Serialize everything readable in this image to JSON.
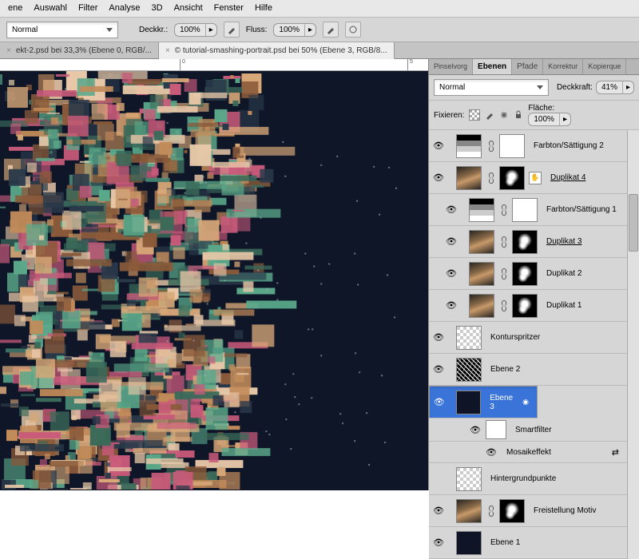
{
  "menu": [
    "ene",
    "Auswahl",
    "Filter",
    "Analyse",
    "3D",
    "Ansicht",
    "Fenster",
    "Hilfe"
  ],
  "toolbar": {
    "blend": "Normal",
    "opacity_lbl": "Deckkr.:",
    "opacity": "100%",
    "flow_lbl": "Fluss:",
    "flow": "100%"
  },
  "doc_tabs": [
    {
      "label": "ekt-2.psd bei 33,3% (Ebene 0, RGB/...",
      "active": false
    },
    {
      "label": "© tutorial-smashing-portrait.psd bei 50% (Ebene 3, RGB/8...",
      "active": true
    }
  ],
  "panel_tabs": [
    "Pinselvorg",
    "Ebenen",
    "Pfade",
    "Korrektur",
    "Kopierque"
  ],
  "panel_tabs_active": 1,
  "layer_opts": {
    "blend": "Normal",
    "opacity_lbl": "Deckkraft:",
    "opacity": "41%",
    "lock_lbl": "Fixieren:",
    "fill_lbl": "Fläche:",
    "fill": "100%"
  },
  "layers": [
    {
      "eye": true,
      "thumbs": [
        "grad",
        "white"
      ],
      "link": true,
      "name": "Farbton/Sättigung 2",
      "u": false
    },
    {
      "eye": true,
      "thumbs": [
        "port",
        "mask"
      ],
      "link": true,
      "name": "Duplikat 4",
      "u": true,
      "hand": true
    },
    {
      "eye": true,
      "thumbs": [
        "grad",
        "white"
      ],
      "link": true,
      "name": "Farbton/Sättigung 1",
      "u": false,
      "indent": 1
    },
    {
      "eye": true,
      "thumbs": [
        "port",
        "mask"
      ],
      "link": true,
      "name": "Duplikat 3",
      "u": true,
      "indent": 1
    },
    {
      "eye": true,
      "thumbs": [
        "port",
        "mask"
      ],
      "link": true,
      "name": "Duplikat 2",
      "u": false,
      "indent": 1
    },
    {
      "eye": true,
      "thumbs": [
        "port",
        "mask"
      ],
      "link": true,
      "name": "Duplikat 1",
      "u": false,
      "indent": 1
    },
    {
      "eye": true,
      "thumbs": [
        "check"
      ],
      "name": "Konturspritzer",
      "u": false
    },
    {
      "eye": true,
      "thumbs": [
        "dots"
      ],
      "name": "Ebene 2",
      "u": false
    },
    {
      "eye": true,
      "thumbs": [
        "dark"
      ],
      "name": "Ebene 3",
      "u": false,
      "selected": true,
      "smart": true
    },
    {
      "eye": false,
      "thumbs": [
        "check"
      ],
      "name": "Hintergrundpunkte",
      "u": false
    },
    {
      "eye": true,
      "thumbs": [
        "port",
        "mask"
      ],
      "link": true,
      "name": "Freistellung Motiv",
      "u": false
    },
    {
      "eye": true,
      "thumbs": [
        "dark"
      ],
      "name": "Ebene 1",
      "u": false
    }
  ],
  "smartfilter": {
    "label": "Smartfilter",
    "effect": "Mosaikeffekt",
    "effect_eye": true
  }
}
